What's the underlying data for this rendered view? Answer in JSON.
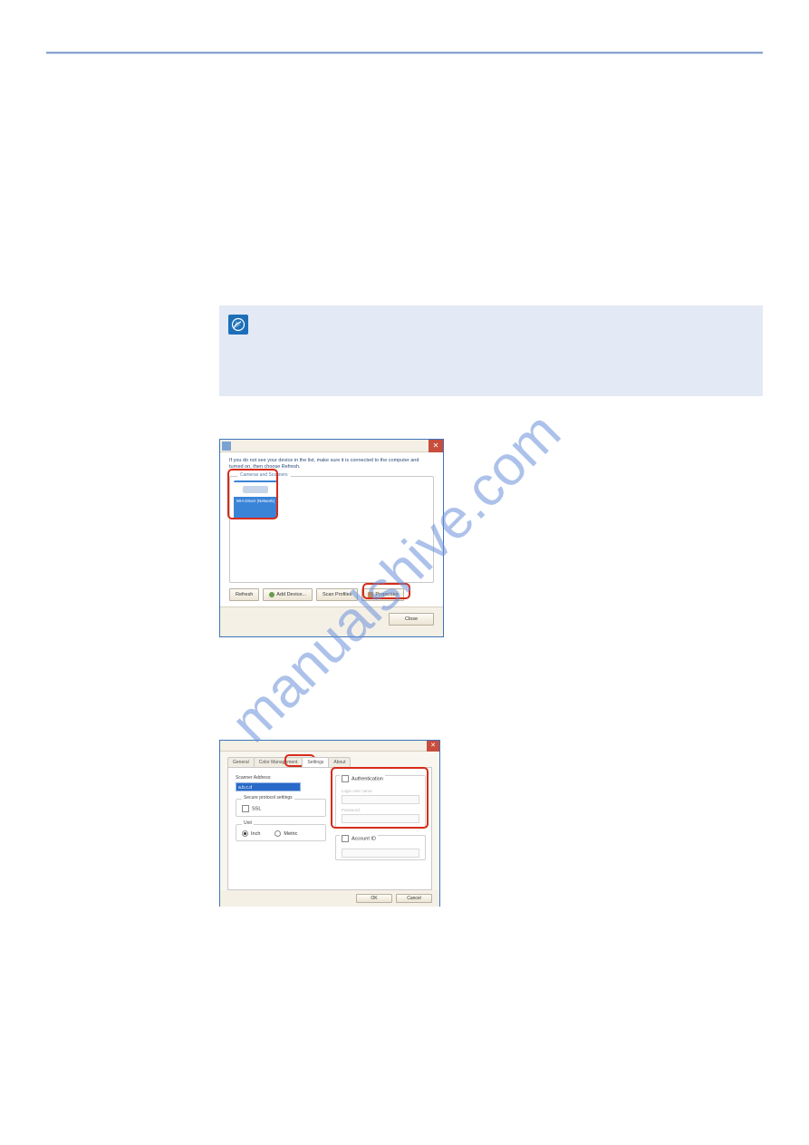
{
  "shot1": {
    "instruction": "If you do not see your device in the list, make sure it is connected to the computer and turned on, then choose Refresh.",
    "group_label": "Cameras and Scanners",
    "device_name": "WIA Driver (Network)",
    "buttons": {
      "refresh": "Refresh",
      "add": "Add Device...",
      "profiles": "Scan Profiles",
      "properties": "Properties"
    },
    "close": "Close"
  },
  "shot2": {
    "tabs": {
      "general": "General",
      "color": "Color Management",
      "settings": "Settings",
      "about": "About"
    },
    "scanner_addr_label": "Scanner Address:",
    "scanner_addr_value": "a.b.c.d",
    "group_spp": "Secure protocol settings",
    "ssl": "SSL",
    "group_unit": "Unit",
    "inch": "Inch",
    "metric": "Metric",
    "auth": "Authentication",
    "login_placeholder": "Login user name:",
    "password_placeholder": "Password:",
    "account_id": "Account ID",
    "ok": "OK",
    "cancel": "Cancel"
  }
}
